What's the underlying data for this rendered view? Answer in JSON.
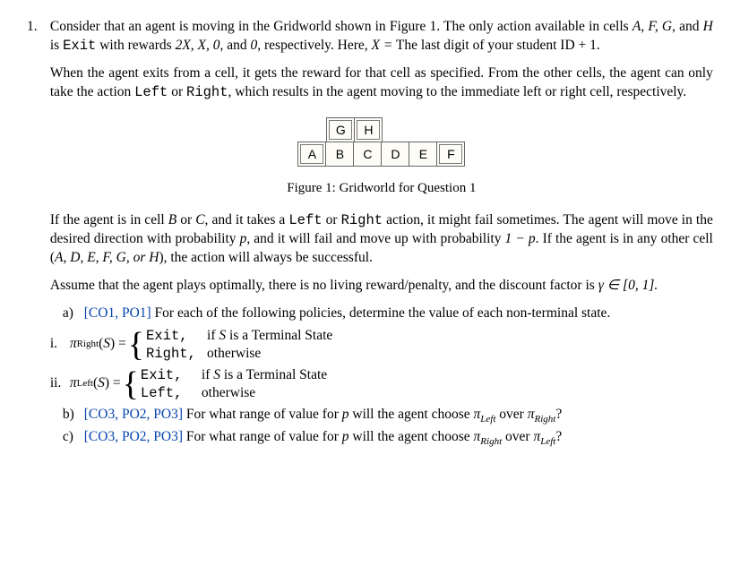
{
  "q_num": "1.",
  "intro_1a": "Consider that an agent is moving in the Gridworld shown in Figure 1. The only action available in cells ",
  "intro_1b": ", and ",
  "intro_1c": " is ",
  "intro_1d": " with rewards ",
  "intro_1e": ", and ",
  "intro_1f": ", respectively. Here, ",
  "intro_1g": " The last digit of your student ID + 1.",
  "cells_afgh": "A, F, G",
  "cell_h": "H",
  "action_exit": "Exit",
  "rewards_abc": "2X, X, 0",
  "reward_d": "0",
  "x_eq": "X =",
  "para2_a": "When the agent exits from a cell, it gets the reward for that cell as specified. From the other cells, the agent can only take the action ",
  "para2_b": " or ",
  "para2_c": ", which results in the agent moving to the immediate left or right cell, respectively.",
  "action_left": "Left",
  "action_right": "Right",
  "grid": {
    "top": [
      "G",
      "H"
    ],
    "bottom": [
      "A",
      "B",
      "C",
      "D",
      "E",
      "F"
    ]
  },
  "fig_caption": "Figure 1: Gridworld for Question 1",
  "para3_a": "If the agent is in cell ",
  "para3_b": " or ",
  "para3_c": ", and it takes a ",
  "para3_d": " or ",
  "para3_e": " action, it might fail sometimes. The agent will move in the desired direction with probability ",
  "para3_f": ", and it will fail and move up with probability ",
  "para3_g": ". If the agent is in any other cell (",
  "para3_h": "), the action will always be successful.",
  "cell_b": "B",
  "cell_c": "C",
  "var_p": "p",
  "one_minus_p": "1 − p",
  "other_cells": "A, D, E, F, G,",
  "or_h": " or H",
  "para4_a": "Assume that the agent plays optimally, there is no living reward/penalty, and the discount factor is ",
  "gamma_range": "γ ∈ [0, 1].",
  "part_a_label": "a)",
  "co_po_a": "[CO1, PO1]",
  "part_a_text": " For each of the following policies, determine the value of each non-terminal state.",
  "sub_i": "i.",
  "sub_ii": "ii.",
  "pi_right_s": "π",
  "pi_right_sub": "Right",
  "pi_left_sub": "Left",
  "of_s": "(S) = ",
  "case_exit": "Exit,",
  "case_right": "Right,",
  "case_left": "Left,",
  "cond_terminal_a": "if ",
  "cond_terminal_s": "S",
  "cond_terminal_b": " is a Terminal State",
  "cond_otherwise": "otherwise",
  "part_b_label": "b)",
  "co_po_bc": "[CO3, PO2, PO3]",
  "part_b_text_a": " For what range of value for ",
  "part_b_text_b": " will the agent choose ",
  "part_b_text_c": " over ",
  "part_b_text_d": "?",
  "part_c_label": "c)",
  "part_c_text_a": " For what range of value for ",
  "part_c_text_b": " will the agent choose ",
  "part_c_text_c": " over ",
  "part_c_text_d": "?"
}
